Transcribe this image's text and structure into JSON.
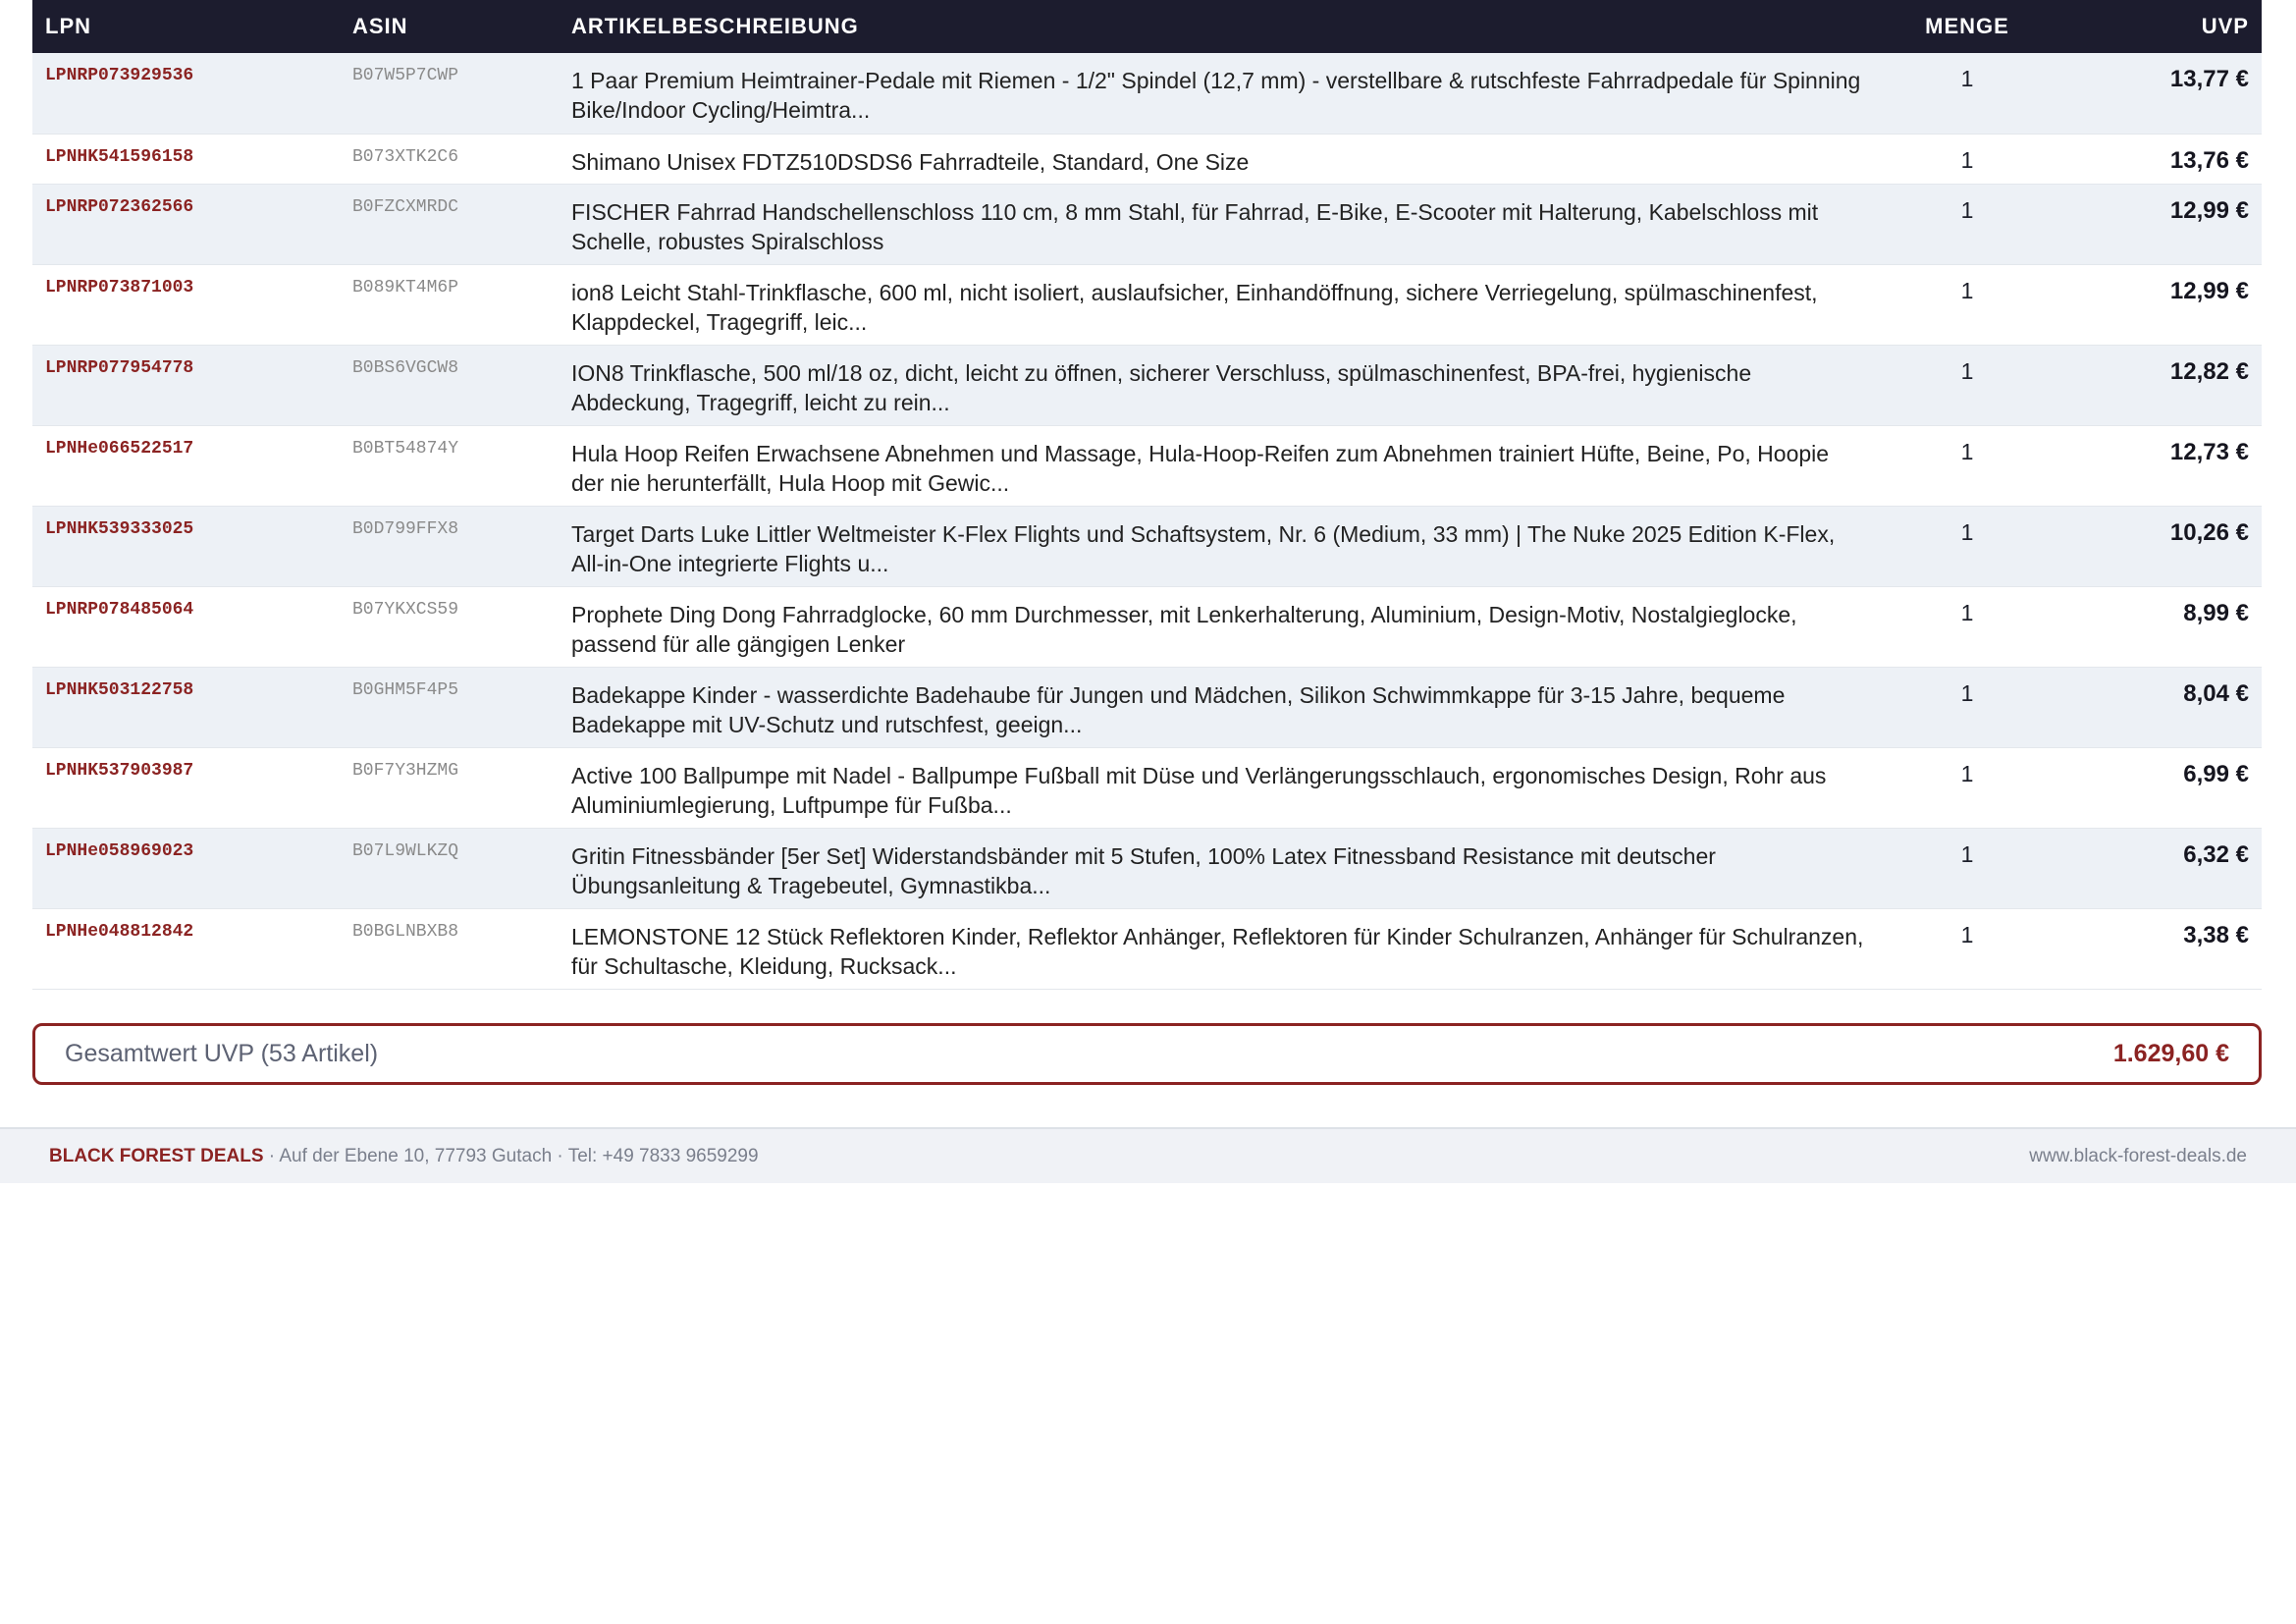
{
  "table": {
    "headers": {
      "lpn": "LPN",
      "asin": "ASIN",
      "description": "ARTIKELBESCHREIBUNG",
      "quantity": "MENGE",
      "uvp": "UVP"
    },
    "rows": [
      {
        "lpn": "LPNRP073929536",
        "asin": "B07W5P7CWP",
        "description": "1 Paar Premium Heimtrainer-Pedale mit Riemen - 1/2\" Spindel (12,7 mm) - verstellbare & rutschfeste Fahrradpedale für Spinning Bike/Indoor Cycling/Heimtra...",
        "quantity": "1",
        "uvp": "13,77 €"
      },
      {
        "lpn": "LPNHK541596158",
        "asin": "B073XTK2C6",
        "description": "Shimano Unisex FDTZ510DSDS6 Fahrradteile, Standard, One Size",
        "quantity": "1",
        "uvp": "13,76 €"
      },
      {
        "lpn": "LPNRP072362566",
        "asin": "B0FZCXMRDC",
        "description": "FISCHER Fahrrad Handschellenschloss 110 cm, 8 mm Stahl, für Fahrrad, E-Bike, E-Scooter mit Halterung, Kabelschloss mit Schelle, robustes Spiralschloss",
        "quantity": "1",
        "uvp": "12,99 €"
      },
      {
        "lpn": "LPNRP073871003",
        "asin": "B089KT4M6P",
        "description": "ion8 Leicht Stahl-Trinkflasche, 600 ml, nicht isoliert, auslaufsicher, Einhandöffnung, sichere Verriegelung, spülmaschinenfest, Klappdeckel, Tragegriff, leic...",
        "quantity": "1",
        "uvp": "12,99 €"
      },
      {
        "lpn": "LPNRP077954778",
        "asin": "B0BS6VGCW8",
        "description": "ION8 Trinkflasche, 500 ml/18 oz, dicht, leicht zu öffnen, sicherer Verschluss, spülmaschinenfest, BPA-frei, hygienische Abdeckung, Tragegriff, leicht zu rein...",
        "quantity": "1",
        "uvp": "12,82 €"
      },
      {
        "lpn": "LPNHe066522517",
        "asin": "B0BT54874Y",
        "description": "Hula Hoop Reifen Erwachsene Abnehmen und Massage, Hula-Hoop-Reifen zum Abnehmen trainiert Hüfte, Beine, Po, Hoopie der nie herunterfällt, Hula Hoop mit Gewic...",
        "quantity": "1",
        "uvp": "12,73 €"
      },
      {
        "lpn": "LPNHK539333025",
        "asin": "B0D799FFX8",
        "description": "Target Darts Luke Littler Weltmeister K-Flex Flights und Schaftsystem, Nr. 6 (Medium, 33 mm) | The Nuke 2025 Edition K-Flex, All-in-One integrierte Flights u...",
        "quantity": "1",
        "uvp": "10,26 €"
      },
      {
        "lpn": "LPNRP078485064",
        "asin": "B07YKXCS59",
        "description": "Prophete Ding Dong Fahrradglocke, 60 mm Durchmesser, mit Lenkerhalterung, Aluminium, Design-Motiv, Nostalgieglocke, passend für alle gängigen Lenker",
        "quantity": "1",
        "uvp": "8,99 €"
      },
      {
        "lpn": "LPNHK503122758",
        "asin": "B0GHM5F4P5",
        "description": "Badekappe Kinder - wasserdichte Badehaube für Jungen und Mädchen, Silikon Schwimmkappe für 3-15 Jahre, bequeme Badekappe mit UV-Schutz und rutschfest, geeign...",
        "quantity": "1",
        "uvp": "8,04 €"
      },
      {
        "lpn": "LPNHK537903987",
        "asin": "B0F7Y3HZMG",
        "description": "Active 100 Ballpumpe mit Nadel - Ballpumpe Fußball mit Düse und Verlängerungsschlauch, ergonomisches Design, Rohr aus Aluminiumlegierung, Luftpumpe für Fußba...",
        "quantity": "1",
        "uvp": "6,99 €"
      },
      {
        "lpn": "LPNHe058969023",
        "asin": "B07L9WLKZQ",
        "description": "Gritin Fitnessbänder [5er Set] Widerstandsbänder mit 5 Stufen, 100% Latex Fitnessband Resistance mit deutscher Übungsanleitung & Tragebeutel, Gymnastikba...",
        "quantity": "1",
        "uvp": "6,32 €"
      },
      {
        "lpn": "LPNHe048812842",
        "asin": "B0BGLNBXB8",
        "description": "LEMONSTONE 12 Stück Reflektoren Kinder, Reflektor Anhänger, Reflektoren für Kinder Schulranzen, Anhänger für Schulranzen, für Schultasche, Kleidung, Rucksack...",
        "quantity": "1",
        "uvp": "3,38 €"
      }
    ]
  },
  "total": {
    "label": "Gesamtwert UVP (53 Artikel)",
    "value": "1.629,60 €"
  },
  "footer": {
    "brand": "BLACK FOREST DEALS",
    "address": " · Auf der Ebene 10, 77793 Gutach · Tel: +49 7833 9659299",
    "website": "www.black-forest-deals.de"
  },
  "colors": {
    "header_bg": "#1c1c2e",
    "accent": "#8b2322",
    "stripe": "#edf1f6"
  }
}
